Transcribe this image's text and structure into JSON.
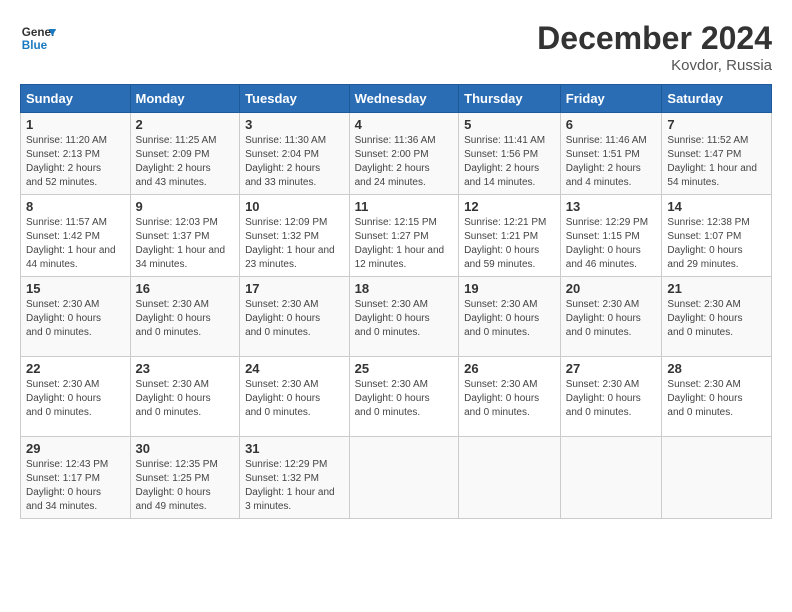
{
  "logo": {
    "line1": "General",
    "line2": "Blue"
  },
  "title": "December 2024",
  "subtitle": "Kovdor, Russia",
  "days_of_week": [
    "Sunday",
    "Monday",
    "Tuesday",
    "Wednesday",
    "Thursday",
    "Friday",
    "Saturday"
  ],
  "weeks": [
    [
      {
        "day": "1",
        "info": "Sunrise: 11:20 AM\nSunset: 2:13 PM\nDaylight: 2 hours\nand 52 minutes."
      },
      {
        "day": "2",
        "info": "Sunrise: 11:25 AM\nSunset: 2:09 PM\nDaylight: 2 hours\nand 43 minutes."
      },
      {
        "day": "3",
        "info": "Sunrise: 11:30 AM\nSunset: 2:04 PM\nDaylight: 2 hours\nand 33 minutes."
      },
      {
        "day": "4",
        "info": "Sunrise: 11:36 AM\nSunset: 2:00 PM\nDaylight: 2 hours\nand 24 minutes."
      },
      {
        "day": "5",
        "info": "Sunrise: 11:41 AM\nSunset: 1:56 PM\nDaylight: 2 hours\nand 14 minutes."
      },
      {
        "day": "6",
        "info": "Sunrise: 11:46 AM\nSunset: 1:51 PM\nDaylight: 2 hours\nand 4 minutes."
      },
      {
        "day": "7",
        "info": "Sunrise: 11:52 AM\nSunset: 1:47 PM\nDaylight: 1 hour and\n54 minutes."
      }
    ],
    [
      {
        "day": "8",
        "info": "Sunrise: 11:57 AM\nSunset: 1:42 PM\nDaylight: 1 hour and\n44 minutes."
      },
      {
        "day": "9",
        "info": "Sunrise: 12:03 PM\nSunset: 1:37 PM\nDaylight: 1 hour and\n34 minutes."
      },
      {
        "day": "10",
        "info": "Sunrise: 12:09 PM\nSunset: 1:32 PM\nDaylight: 1 hour and\n23 minutes."
      },
      {
        "day": "11",
        "info": "Sunrise: 12:15 PM\nSunset: 1:27 PM\nDaylight: 1 hour and\n12 minutes."
      },
      {
        "day": "12",
        "info": "Sunrise: 12:21 PM\nSunset: 1:21 PM\nDaylight: 0 hours\nand 59 minutes."
      },
      {
        "day": "13",
        "info": "Sunrise: 12:29 PM\nSunset: 1:15 PM\nDaylight: 0 hours\nand 46 minutes."
      },
      {
        "day": "14",
        "info": "Sunrise: 12:38 PM\nSunset: 1:07 PM\nDaylight: 0 hours\nand 29 minutes."
      }
    ],
    [
      {
        "day": "15",
        "info": "Sunset: 2:30 AM\nDaylight: 0 hours\nand 0 minutes."
      },
      {
        "day": "16",
        "info": "Sunset: 2:30 AM\nDaylight: 0 hours\nand 0 minutes."
      },
      {
        "day": "17",
        "info": "Sunset: 2:30 AM\nDaylight: 0 hours\nand 0 minutes."
      },
      {
        "day": "18",
        "info": "Sunset: 2:30 AM\nDaylight: 0 hours\nand 0 minutes."
      },
      {
        "day": "19",
        "info": "Sunset: 2:30 AM\nDaylight: 0 hours\nand 0 minutes."
      },
      {
        "day": "20",
        "info": "Sunset: 2:30 AM\nDaylight: 0 hours\nand 0 minutes."
      },
      {
        "day": "21",
        "info": "Sunset: 2:30 AM\nDaylight: 0 hours\nand 0 minutes."
      }
    ],
    [
      {
        "day": "22",
        "info": "Sunset: 2:30 AM\nDaylight: 0 hours\nand 0 minutes."
      },
      {
        "day": "23",
        "info": "Sunset: 2:30 AM\nDaylight: 0 hours\nand 0 minutes."
      },
      {
        "day": "24",
        "info": "Sunset: 2:30 AM\nDaylight: 0 hours\nand 0 minutes."
      },
      {
        "day": "25",
        "info": "Sunset: 2:30 AM\nDaylight: 0 hours\nand 0 minutes."
      },
      {
        "day": "26",
        "info": "Sunset: 2:30 AM\nDaylight: 0 hours\nand 0 minutes."
      },
      {
        "day": "27",
        "info": "Sunset: 2:30 AM\nDaylight: 0 hours\nand 0 minutes."
      },
      {
        "day": "28",
        "info": "Sunset: 2:30 AM\nDaylight: 0 hours\nand 0 minutes."
      }
    ],
    [
      {
        "day": "29",
        "info": "Sunrise: 12:43 PM\nSunset: 1:17 PM\nDaylight: 0 hours\nand 34 minutes."
      },
      {
        "day": "30",
        "info": "Sunrise: 12:35 PM\nSunset: 1:25 PM\nDaylight: 0 hours\nand 49 minutes."
      },
      {
        "day": "31",
        "info": "Sunrise: 12:29 PM\nSunset: 1:32 PM\nDaylight: 1 hour and\n3 minutes."
      },
      {
        "day": "",
        "info": ""
      },
      {
        "day": "",
        "info": ""
      },
      {
        "day": "",
        "info": ""
      },
      {
        "day": "",
        "info": ""
      }
    ]
  ]
}
